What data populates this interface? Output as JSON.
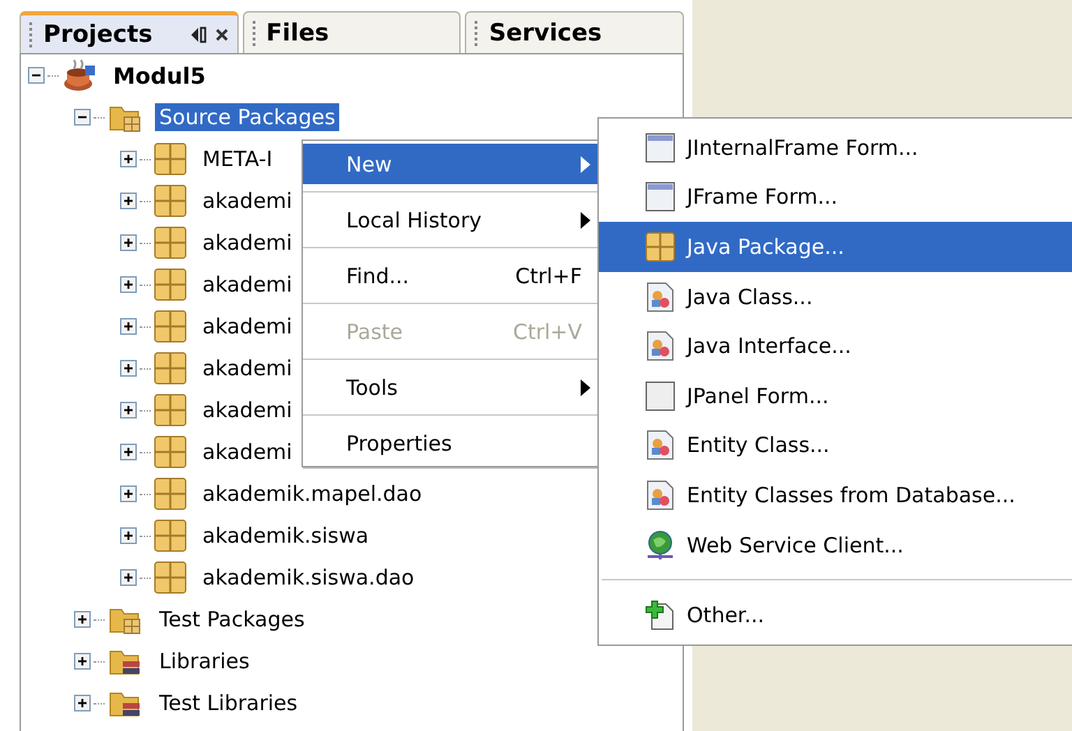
{
  "tabs": [
    {
      "label": "Projects",
      "selected": true,
      "closable": true
    },
    {
      "label": "Files",
      "selected": false,
      "closable": false
    },
    {
      "label": "Services",
      "selected": false,
      "closable": false
    }
  ],
  "tree": [
    {
      "label": "Modul5",
      "kind": "project",
      "expanded": true,
      "selected": false,
      "children": [
        {
          "label": "Source Packages",
          "kind": "source-folder",
          "expanded": true,
          "selected": true,
          "children": [
            {
              "label": "META-I",
              "kind": "package",
              "expanded": false,
              "selected": false
            },
            {
              "label": "akademi",
              "kind": "package",
              "expanded": false,
              "selected": false
            },
            {
              "label": "akademi",
              "kind": "package",
              "expanded": false,
              "selected": false
            },
            {
              "label": "akademi",
              "kind": "package",
              "expanded": false,
              "selected": false
            },
            {
              "label": "akademi",
              "kind": "package",
              "expanded": false,
              "selected": false
            },
            {
              "label": "akademi",
              "kind": "package",
              "expanded": false,
              "selected": false
            },
            {
              "label": "akademi",
              "kind": "package",
              "expanded": false,
              "selected": false
            },
            {
              "label": "akademi",
              "kind": "package",
              "expanded": false,
              "selected": false
            },
            {
              "label": "akademik.mapel.dao",
              "kind": "package",
              "expanded": false,
              "selected": false
            },
            {
              "label": "akademik.siswa",
              "kind": "package",
              "expanded": false,
              "selected": false
            },
            {
              "label": "akademik.siswa.dao",
              "kind": "package",
              "expanded": false,
              "selected": false
            }
          ]
        },
        {
          "label": "Test Packages",
          "kind": "source-folder",
          "expanded": false,
          "selected": false
        },
        {
          "label": "Libraries",
          "kind": "library",
          "expanded": false,
          "selected": false
        },
        {
          "label": "Test Libraries",
          "kind": "library",
          "expanded": false,
          "selected": false
        }
      ]
    }
  ],
  "context_menu": {
    "items": [
      {
        "kind": "item",
        "label": "New",
        "submenu": true,
        "selected": true,
        "disabled": false
      },
      {
        "kind": "separator"
      },
      {
        "kind": "item",
        "label": "Local History",
        "submenu": true,
        "selected": false,
        "disabled": false
      },
      {
        "kind": "separator"
      },
      {
        "kind": "item",
        "label": "Find...",
        "shortcut": "Ctrl+F",
        "submenu": false,
        "selected": false,
        "disabled": false
      },
      {
        "kind": "separator"
      },
      {
        "kind": "item",
        "label": "Paste",
        "shortcut": "Ctrl+V",
        "submenu": false,
        "selected": false,
        "disabled": true
      },
      {
        "kind": "separator"
      },
      {
        "kind": "item",
        "label": "Tools",
        "submenu": true,
        "selected": false,
        "disabled": false
      },
      {
        "kind": "separator"
      },
      {
        "kind": "item",
        "label": "Properties",
        "submenu": false,
        "selected": false,
        "disabled": false
      }
    ]
  },
  "submenu": {
    "items": [
      {
        "kind": "frame",
        "label": "JInternalFrame Form...",
        "selected": false
      },
      {
        "kind": "frame",
        "label": "JFrame Form...",
        "selected": false
      },
      {
        "kind": "package",
        "label": "Java Package...",
        "selected": true
      },
      {
        "kind": "class",
        "label": "Java Class...",
        "selected": false
      },
      {
        "kind": "class",
        "label": "Java Interface...",
        "selected": false
      },
      {
        "kind": "panel",
        "label": "JPanel Form...",
        "selected": false
      },
      {
        "kind": "class",
        "label": "Entity Class...",
        "selected": false
      },
      {
        "kind": "class",
        "label": "Entity Classes from Database...",
        "selected": false
      },
      {
        "kind": "globe",
        "label": "Web Service Client...",
        "selected": false
      },
      {
        "kind": "separator"
      },
      {
        "kind": "new-file",
        "label": "Other...",
        "selected": false
      }
    ]
  }
}
